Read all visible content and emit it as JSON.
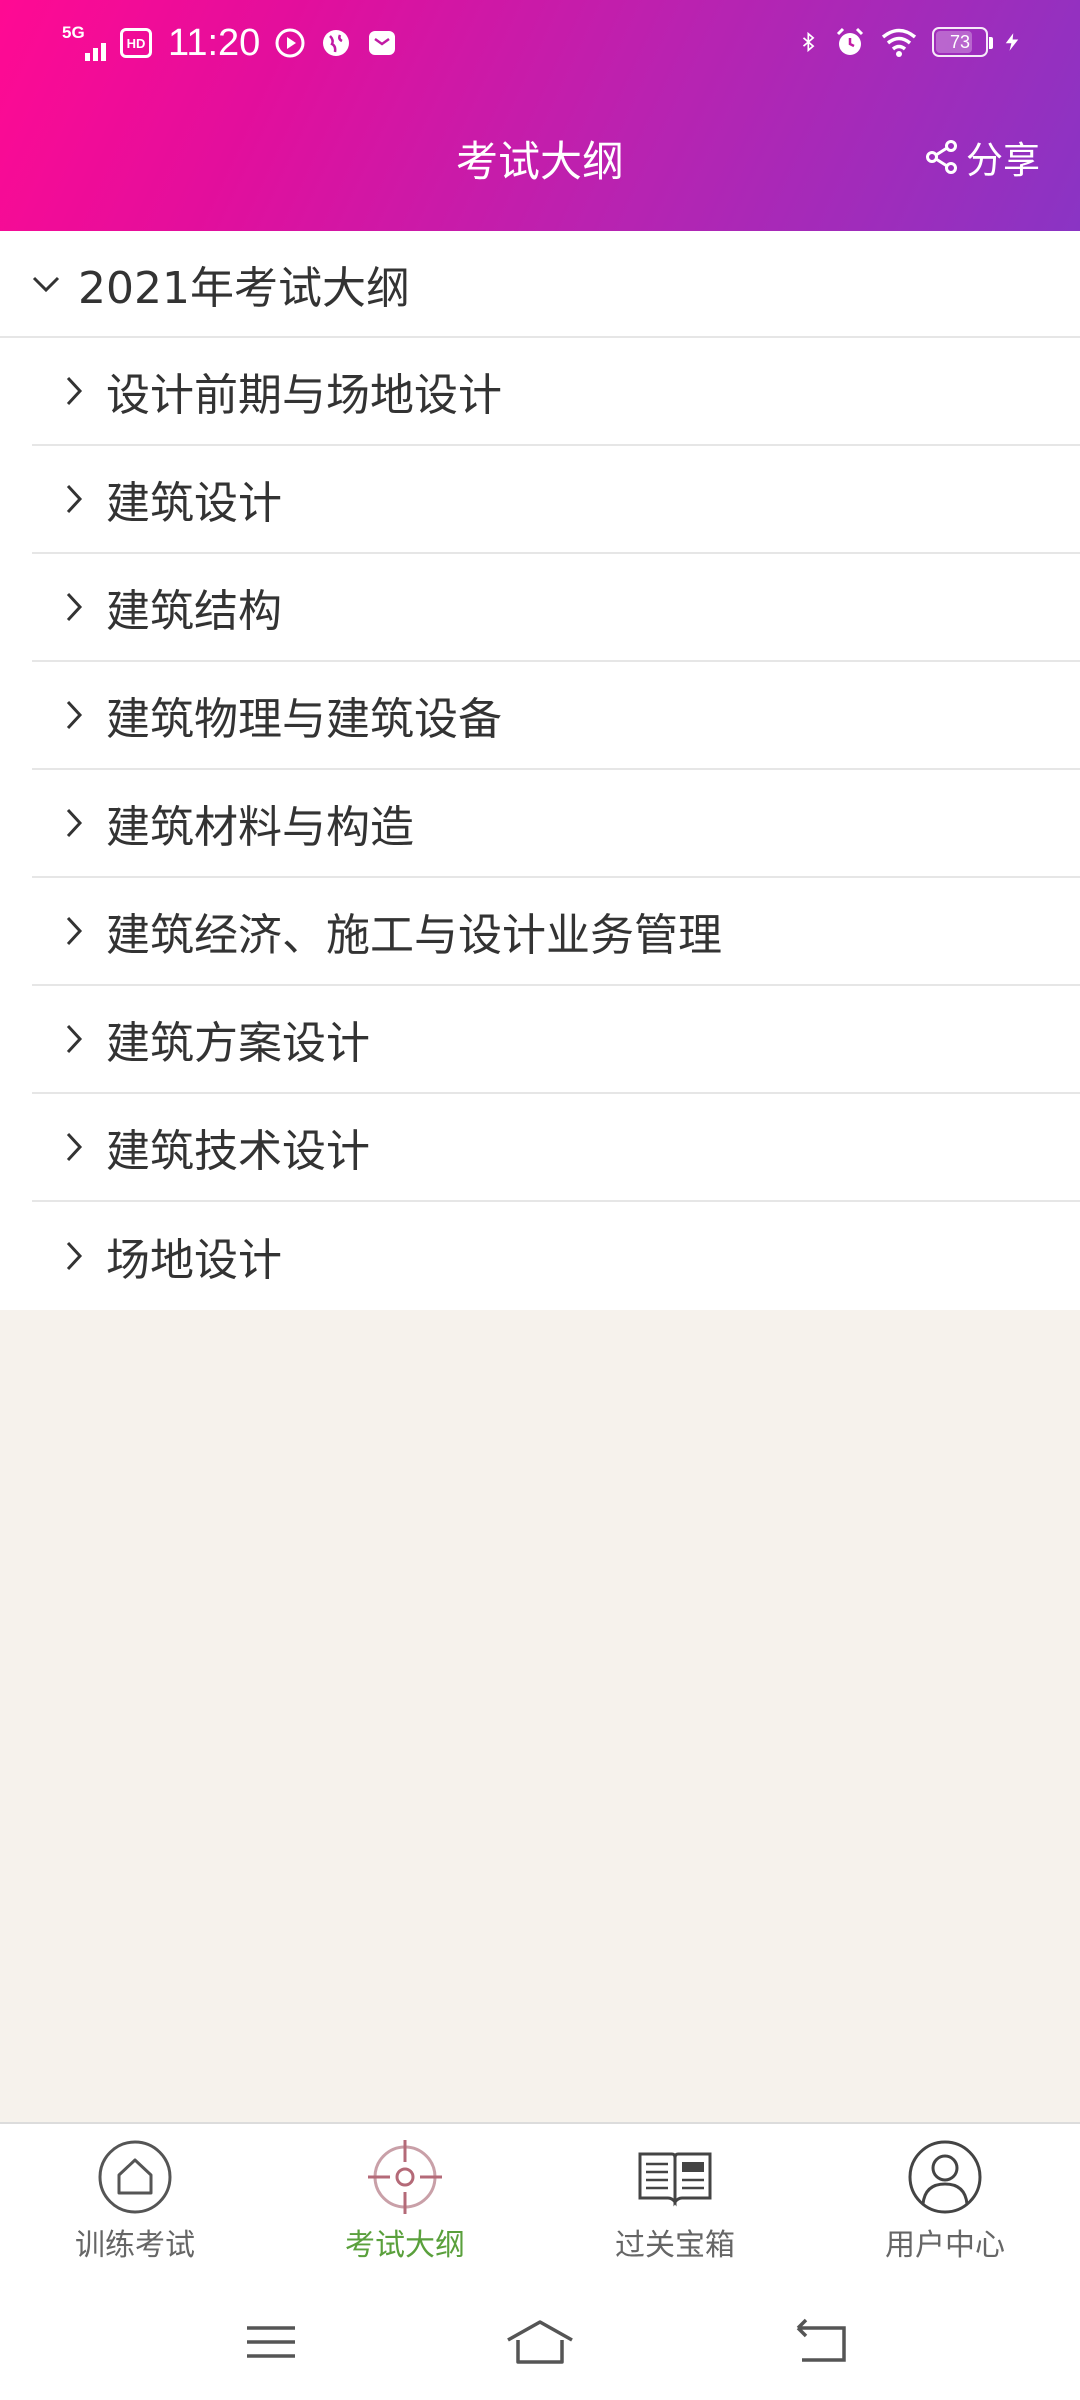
{
  "status_bar": {
    "network": "5G",
    "hd": "HD",
    "time": "11:20",
    "battery": "73"
  },
  "header": {
    "title": "考试大纲",
    "share_label": "分享"
  },
  "outline": {
    "group_label": "2021年考试大纲",
    "items": [
      {
        "label": "设计前期与场地设计"
      },
      {
        "label": "建筑设计"
      },
      {
        "label": "建筑结构"
      },
      {
        "label": "建筑物理与建筑设备"
      },
      {
        "label": "建筑材料与构造"
      },
      {
        "label": "建筑经济、施工与设计业务管理"
      },
      {
        "label": "建筑方案设计"
      },
      {
        "label": "建筑技术设计"
      },
      {
        "label": "场地设计"
      }
    ]
  },
  "tabbar": {
    "tabs": [
      {
        "label": "训练考试",
        "icon": "home-icon"
      },
      {
        "label": "考试大纲",
        "icon": "target-icon",
        "active": true
      },
      {
        "label": "过关宝箱",
        "icon": "book-icon"
      },
      {
        "label": "用户中心",
        "icon": "user-icon"
      }
    ]
  },
  "colors": {
    "header_gradient_start": "#ff0a93",
    "header_gradient_end": "#8a34c4",
    "active_tab": "#5aa03c",
    "page_background": "#f6f2ec"
  }
}
